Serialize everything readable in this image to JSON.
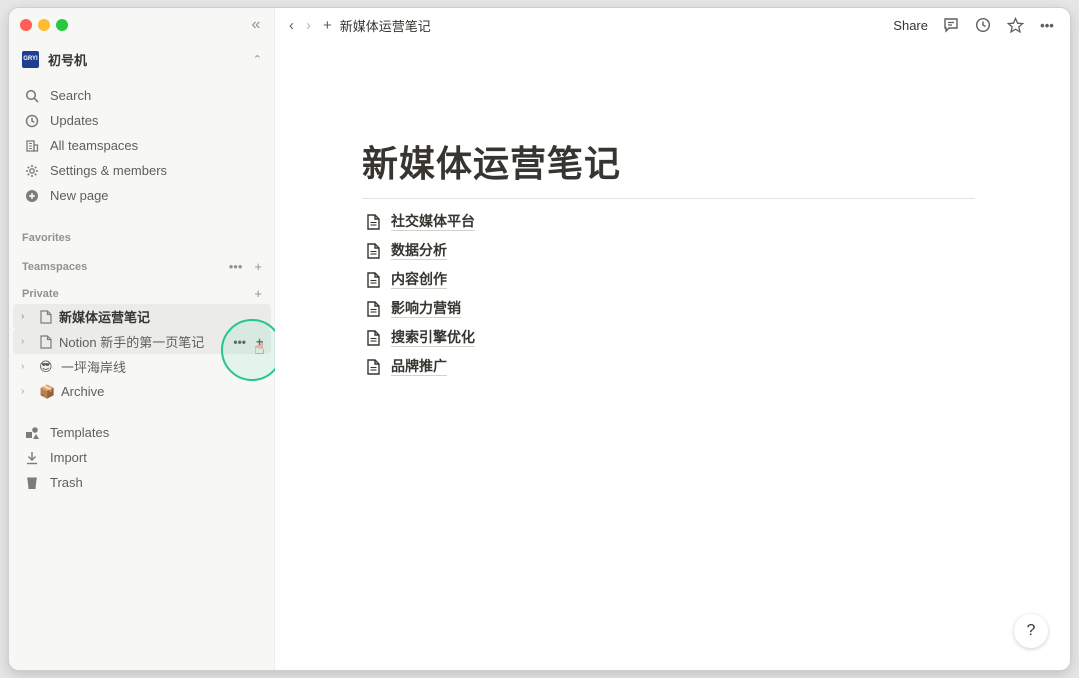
{
  "workspace": {
    "logo_text": "GRYI",
    "name": "初号机"
  },
  "nav": {
    "search": "Search",
    "updates": "Updates",
    "teamspaces": "All teamspaces",
    "settings": "Settings & members",
    "new_page": "New page"
  },
  "sections": {
    "favorites": "Favorites",
    "teamspaces": "Teamspaces",
    "private": "Private"
  },
  "tree": [
    {
      "label": "新媒体运营笔记",
      "icon": "page-icon"
    },
    {
      "label": "Notion 新手的第一页笔记",
      "icon": "page-icon"
    },
    {
      "label": "一坪海岸线",
      "emoji": "😎"
    },
    {
      "label": "Archive",
      "emoji": "📦"
    }
  ],
  "bottom_nav": {
    "templates": "Templates",
    "import": "Import",
    "trash": "Trash"
  },
  "topbar": {
    "breadcrumb": "新媒体运营笔记",
    "share": "Share"
  },
  "page": {
    "title": "新媒体运营笔记",
    "subpages": [
      "社交媒体平台",
      "数据分析",
      "内容创作",
      "影响力营销",
      "搜索引擎优化",
      "品牌推广"
    ]
  },
  "help": "?",
  "colors": {
    "accent_ring": "#27c48c",
    "cursor": "#e83a1e",
    "sidebar_bg": "#f7f7f5"
  }
}
